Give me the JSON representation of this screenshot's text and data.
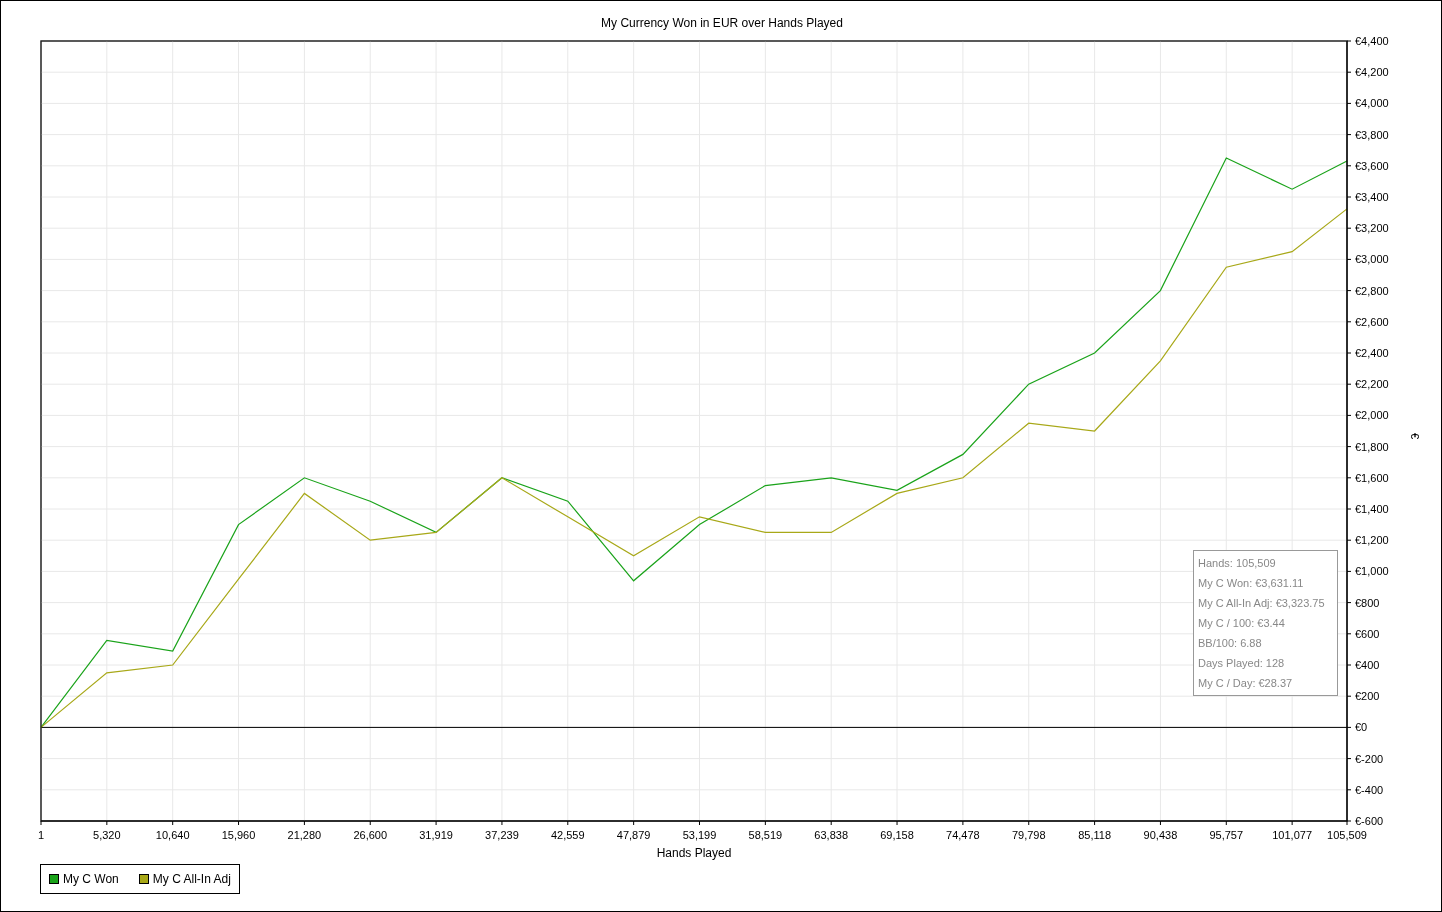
{
  "chart": {
    "chart_data": {
      "type": "line",
      "title": "My Currency Won in EUR over Hands Played",
      "xlabel": "Hands Played",
      "ylabel": "€",
      "x": [
        1,
        5320,
        10640,
        15960,
        21280,
        26600,
        31919,
        37239,
        42559,
        47879,
        53199,
        58519,
        63838,
        69158,
        74478,
        79798,
        85118,
        90438,
        95757,
        101077,
        105509
      ],
      "series": [
        {
          "name": "My C Won",
          "color": "#1aa31a",
          "values": [
            0,
            557,
            490,
            1300,
            1600,
            1450,
            1250,
            1600,
            1450,
            940,
            1300,
            1550,
            1600,
            1520,
            1750,
            2200,
            2400,
            2800,
            3650,
            3450,
            3631
          ]
        },
        {
          "name": "My C All-In Adj",
          "color": "#a8a818",
          "values": [
            0,
            350,
            400,
            950,
            1500,
            1200,
            1250,
            1600,
            1350,
            1100,
            1350,
            1250,
            1250,
            1500,
            1600,
            1950,
            1900,
            2350,
            2950,
            3050,
            3324
          ]
        }
      ],
      "grid": true,
      "xlim": [
        1,
        105509
      ],
      "ylim": [
        -600,
        4400
      ],
      "xticks": [
        {
          "value": 1,
          "label": "1"
        },
        {
          "value": 5320,
          "label": "5,320"
        },
        {
          "value": 10640,
          "label": "10,640"
        },
        {
          "value": 15960,
          "label": "15,960"
        },
        {
          "value": 21280,
          "label": "21,280"
        },
        {
          "value": 26600,
          "label": "26,600"
        },
        {
          "value": 31919,
          "label": "31,919"
        },
        {
          "value": 37239,
          "label": "37,239"
        },
        {
          "value": 42559,
          "label": "42,559"
        },
        {
          "value": 47879,
          "label": "47,879"
        },
        {
          "value": 53199,
          "label": "53,199"
        },
        {
          "value": 58519,
          "label": "58,519"
        },
        {
          "value": 63838,
          "label": "63,838"
        },
        {
          "value": 69158,
          "label": "69,158"
        },
        {
          "value": 74478,
          "label": "74,478"
        },
        {
          "value": 79798,
          "label": "79,798"
        },
        {
          "value": 85118,
          "label": "85,118"
        },
        {
          "value": 90438,
          "label": "90,438"
        },
        {
          "value": 95757,
          "label": "95,757"
        },
        {
          "value": 101077,
          "label": "101,077"
        },
        {
          "value": 105509,
          "label": "105,509"
        }
      ],
      "yticks": [
        {
          "value": -600,
          "label": "€-600"
        },
        {
          "value": -400,
          "label": "€-400"
        },
        {
          "value": -200,
          "label": "€-200"
        },
        {
          "value": 0,
          "label": "€0"
        },
        {
          "value": 200,
          "label": "€200"
        },
        {
          "value": 400,
          "label": "€400"
        },
        {
          "value": 600,
          "label": "€600"
        },
        {
          "value": 800,
          "label": "€800"
        },
        {
          "value": 1000,
          "label": "€1,000"
        },
        {
          "value": 1200,
          "label": "€1,200"
        },
        {
          "value": 1400,
          "label": "€1,400"
        },
        {
          "value": 1600,
          "label": "€1,600"
        },
        {
          "value": 1800,
          "label": "€1,800"
        },
        {
          "value": 2000,
          "label": "€2,000"
        },
        {
          "value": 2200,
          "label": "€2,200"
        },
        {
          "value": 2400,
          "label": "€2,400"
        },
        {
          "value": 2600,
          "label": "€2,600"
        },
        {
          "value": 2800,
          "label": "€2,800"
        },
        {
          "value": 3000,
          "label": "€3,000"
        },
        {
          "value": 3200,
          "label": "€3,200"
        },
        {
          "value": 3400,
          "label": "€3,400"
        },
        {
          "value": 3600,
          "label": "€3,600"
        },
        {
          "value": 3800,
          "label": "€3,800"
        },
        {
          "value": 4000,
          "label": "€4,000"
        },
        {
          "value": 4200,
          "label": "€4,200"
        },
        {
          "value": 4400,
          "label": "€4,400"
        }
      ]
    }
  },
  "stats": [
    "Hands: 105,509",
    "My C Won: €3,631.11",
    "My C All-In Adj: €3,323.75",
    "My C / 100: €3.44",
    "BB/100: 6.88",
    "Days Played: 128",
    "My C / Day: €28.37"
  ]
}
